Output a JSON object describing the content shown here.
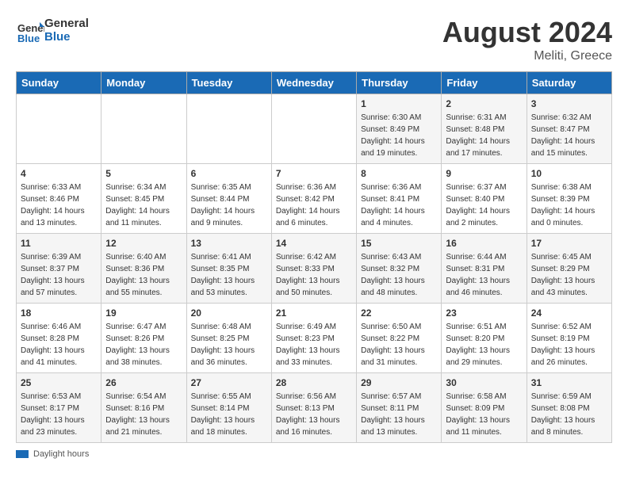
{
  "logo": {
    "line1": "General",
    "line2": "Blue"
  },
  "title": "August 2024",
  "subtitle": "Meliti, Greece",
  "headers": [
    "Sunday",
    "Monday",
    "Tuesday",
    "Wednesday",
    "Thursday",
    "Friday",
    "Saturday"
  ],
  "weeks": [
    [
      {
        "day": "",
        "sunrise": "",
        "sunset": "",
        "daylight": ""
      },
      {
        "day": "",
        "sunrise": "",
        "sunset": "",
        "daylight": ""
      },
      {
        "day": "",
        "sunrise": "",
        "sunset": "",
        "daylight": ""
      },
      {
        "day": "",
        "sunrise": "",
        "sunset": "",
        "daylight": ""
      },
      {
        "day": "1",
        "sunrise": "Sunrise: 6:30 AM",
        "sunset": "Sunset: 8:49 PM",
        "daylight": "Daylight: 14 hours and 19 minutes."
      },
      {
        "day": "2",
        "sunrise": "Sunrise: 6:31 AM",
        "sunset": "Sunset: 8:48 PM",
        "daylight": "Daylight: 14 hours and 17 minutes."
      },
      {
        "day": "3",
        "sunrise": "Sunrise: 6:32 AM",
        "sunset": "Sunset: 8:47 PM",
        "daylight": "Daylight: 14 hours and 15 minutes."
      }
    ],
    [
      {
        "day": "4",
        "sunrise": "Sunrise: 6:33 AM",
        "sunset": "Sunset: 8:46 PM",
        "daylight": "Daylight: 14 hours and 13 minutes."
      },
      {
        "day": "5",
        "sunrise": "Sunrise: 6:34 AM",
        "sunset": "Sunset: 8:45 PM",
        "daylight": "Daylight: 14 hours and 11 minutes."
      },
      {
        "day": "6",
        "sunrise": "Sunrise: 6:35 AM",
        "sunset": "Sunset: 8:44 PM",
        "daylight": "Daylight: 14 hours and 9 minutes."
      },
      {
        "day": "7",
        "sunrise": "Sunrise: 6:36 AM",
        "sunset": "Sunset: 8:42 PM",
        "daylight": "Daylight: 14 hours and 6 minutes."
      },
      {
        "day": "8",
        "sunrise": "Sunrise: 6:36 AM",
        "sunset": "Sunset: 8:41 PM",
        "daylight": "Daylight: 14 hours and 4 minutes."
      },
      {
        "day": "9",
        "sunrise": "Sunrise: 6:37 AM",
        "sunset": "Sunset: 8:40 PM",
        "daylight": "Daylight: 14 hours and 2 minutes."
      },
      {
        "day": "10",
        "sunrise": "Sunrise: 6:38 AM",
        "sunset": "Sunset: 8:39 PM",
        "daylight": "Daylight: 14 hours and 0 minutes."
      }
    ],
    [
      {
        "day": "11",
        "sunrise": "Sunrise: 6:39 AM",
        "sunset": "Sunset: 8:37 PM",
        "daylight": "Daylight: 13 hours and 57 minutes."
      },
      {
        "day": "12",
        "sunrise": "Sunrise: 6:40 AM",
        "sunset": "Sunset: 8:36 PM",
        "daylight": "Daylight: 13 hours and 55 minutes."
      },
      {
        "day": "13",
        "sunrise": "Sunrise: 6:41 AM",
        "sunset": "Sunset: 8:35 PM",
        "daylight": "Daylight: 13 hours and 53 minutes."
      },
      {
        "day": "14",
        "sunrise": "Sunrise: 6:42 AM",
        "sunset": "Sunset: 8:33 PM",
        "daylight": "Daylight: 13 hours and 50 minutes."
      },
      {
        "day": "15",
        "sunrise": "Sunrise: 6:43 AM",
        "sunset": "Sunset: 8:32 PM",
        "daylight": "Daylight: 13 hours and 48 minutes."
      },
      {
        "day": "16",
        "sunrise": "Sunrise: 6:44 AM",
        "sunset": "Sunset: 8:31 PM",
        "daylight": "Daylight: 13 hours and 46 minutes."
      },
      {
        "day": "17",
        "sunrise": "Sunrise: 6:45 AM",
        "sunset": "Sunset: 8:29 PM",
        "daylight": "Daylight: 13 hours and 43 minutes."
      }
    ],
    [
      {
        "day": "18",
        "sunrise": "Sunrise: 6:46 AM",
        "sunset": "Sunset: 8:28 PM",
        "daylight": "Daylight: 13 hours and 41 minutes."
      },
      {
        "day": "19",
        "sunrise": "Sunrise: 6:47 AM",
        "sunset": "Sunset: 8:26 PM",
        "daylight": "Daylight: 13 hours and 38 minutes."
      },
      {
        "day": "20",
        "sunrise": "Sunrise: 6:48 AM",
        "sunset": "Sunset: 8:25 PM",
        "daylight": "Daylight: 13 hours and 36 minutes."
      },
      {
        "day": "21",
        "sunrise": "Sunrise: 6:49 AM",
        "sunset": "Sunset: 8:23 PM",
        "daylight": "Daylight: 13 hours and 33 minutes."
      },
      {
        "day": "22",
        "sunrise": "Sunrise: 6:50 AM",
        "sunset": "Sunset: 8:22 PM",
        "daylight": "Daylight: 13 hours and 31 minutes."
      },
      {
        "day": "23",
        "sunrise": "Sunrise: 6:51 AM",
        "sunset": "Sunset: 8:20 PM",
        "daylight": "Daylight: 13 hours and 29 minutes."
      },
      {
        "day": "24",
        "sunrise": "Sunrise: 6:52 AM",
        "sunset": "Sunset: 8:19 PM",
        "daylight": "Daylight: 13 hours and 26 minutes."
      }
    ],
    [
      {
        "day": "25",
        "sunrise": "Sunrise: 6:53 AM",
        "sunset": "Sunset: 8:17 PM",
        "daylight": "Daylight: 13 hours and 23 minutes."
      },
      {
        "day": "26",
        "sunrise": "Sunrise: 6:54 AM",
        "sunset": "Sunset: 8:16 PM",
        "daylight": "Daylight: 13 hours and 21 minutes."
      },
      {
        "day": "27",
        "sunrise": "Sunrise: 6:55 AM",
        "sunset": "Sunset: 8:14 PM",
        "daylight": "Daylight: 13 hours and 18 minutes."
      },
      {
        "day": "28",
        "sunrise": "Sunrise: 6:56 AM",
        "sunset": "Sunset: 8:13 PM",
        "daylight": "Daylight: 13 hours and 16 minutes."
      },
      {
        "day": "29",
        "sunrise": "Sunrise: 6:57 AM",
        "sunset": "Sunset: 8:11 PM",
        "daylight": "Daylight: 13 hours and 13 minutes."
      },
      {
        "day": "30",
        "sunrise": "Sunrise: 6:58 AM",
        "sunset": "Sunset: 8:09 PM",
        "daylight": "Daylight: 13 hours and 11 minutes."
      },
      {
        "day": "31",
        "sunrise": "Sunrise: 6:59 AM",
        "sunset": "Sunset: 8:08 PM",
        "daylight": "Daylight: 13 hours and 8 minutes."
      }
    ]
  ],
  "footer": {
    "daylight_label": "Daylight hours"
  }
}
